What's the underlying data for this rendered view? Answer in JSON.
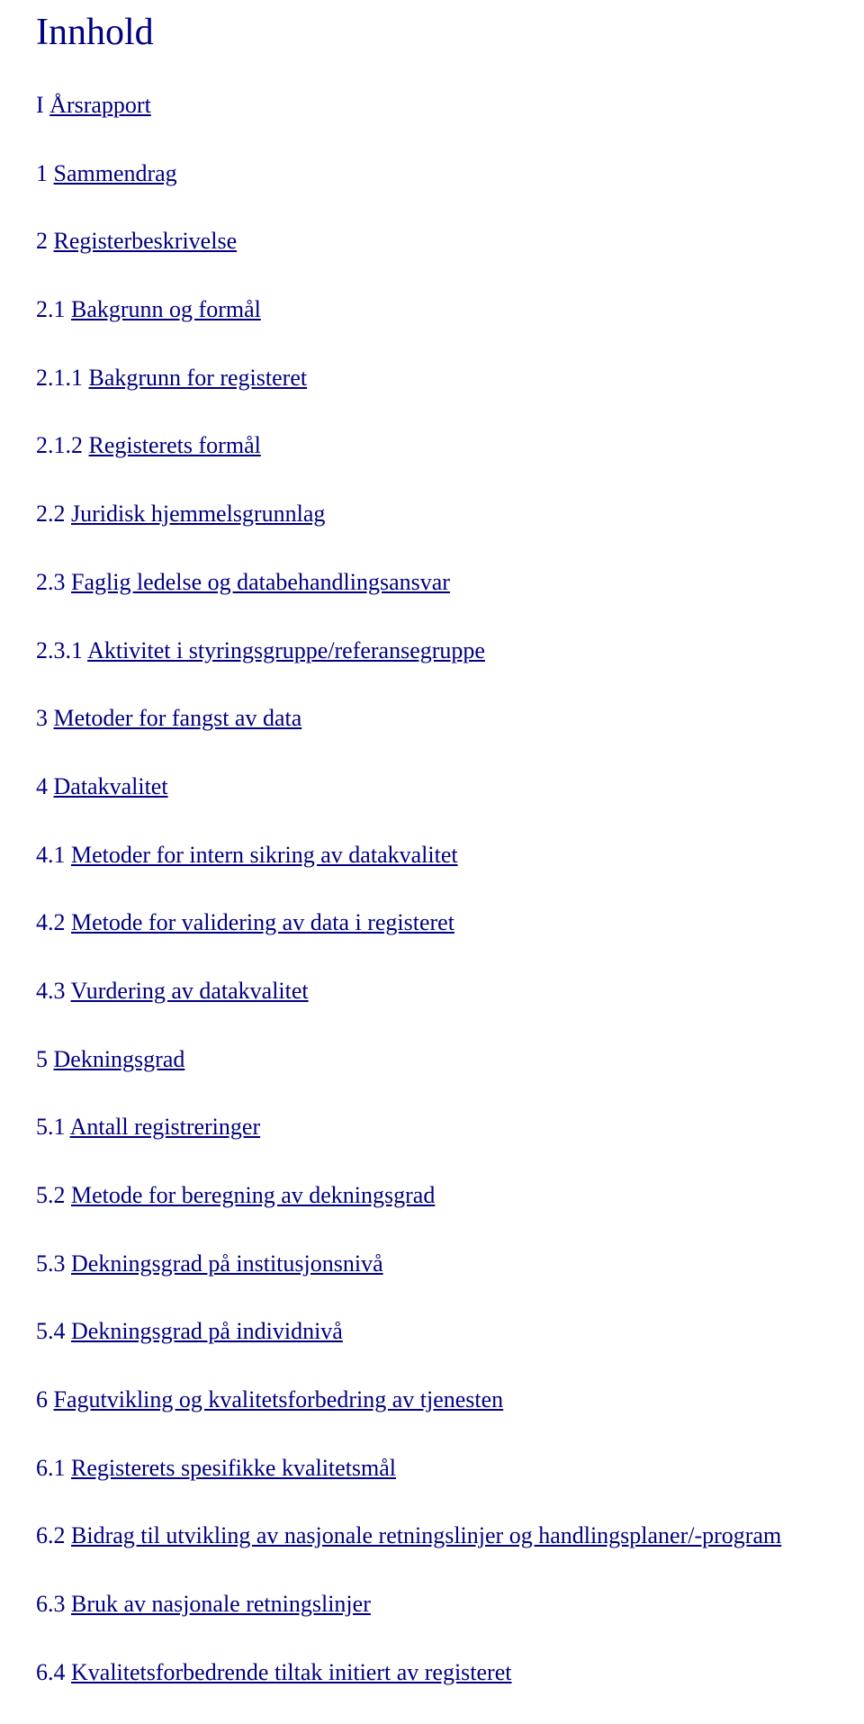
{
  "title": "Innhold",
  "items": [
    {
      "prefix": "I",
      "label": "Årsrapport"
    },
    {
      "prefix": "1",
      "label": "Sammendrag"
    },
    {
      "prefix": "2",
      "label": "Registerbeskrivelse"
    },
    {
      "prefix": "2.1",
      "label": "Bakgrunn og formål"
    },
    {
      "prefix": "2.1.1",
      "label": "Bakgrunn for registeret"
    },
    {
      "prefix": "2.1.2",
      "label": "Registerets formål"
    },
    {
      "prefix": "2.2",
      "label": "Juridisk hjemmelsgrunnlag"
    },
    {
      "prefix": "2.3",
      "label": "Faglig ledelse og databehandlingsansvar"
    },
    {
      "prefix": "2.3.1",
      "label": "Aktivitet i styringsgruppe/referansegruppe"
    },
    {
      "prefix": "3",
      "label": "Metoder for fangst av data"
    },
    {
      "prefix": "4",
      "label": "Datakvalitet"
    },
    {
      "prefix": "4.1",
      "label": "Metoder for intern sikring av datakvalitet"
    },
    {
      "prefix": "4.2",
      "label": "Metode for validering av data i registeret"
    },
    {
      "prefix": "4.3",
      "label": "Vurdering av datakvalitet"
    },
    {
      "prefix": "5",
      "label": "Dekningsgrad"
    },
    {
      "prefix": "5.1",
      "label": "Antall registreringer"
    },
    {
      "prefix": "5.2",
      "label": "Metode for beregning av dekningsgrad"
    },
    {
      "prefix": "5.3",
      "label": "Dekningsgrad på institusjonsnivå"
    },
    {
      "prefix": "5.4",
      "label": "Dekningsgrad på individnivå"
    },
    {
      "prefix": "6",
      "label": "Fagutvikling og kvalitetsforbedring av tjenesten"
    },
    {
      "prefix": "6.1",
      "label": "Registerets spesifikke kvalitetsmål"
    },
    {
      "prefix": "6.2",
      "label": "Bidrag til utvikling av nasjonale retningslinjer og handlingsplaner/-program"
    },
    {
      "prefix": "6.3",
      "label": "Bruk av nasjonale retningslinjer"
    },
    {
      "prefix": "6.4",
      "label": "Kvalitetsforbedrende tiltak initiert av registeret"
    }
  ]
}
